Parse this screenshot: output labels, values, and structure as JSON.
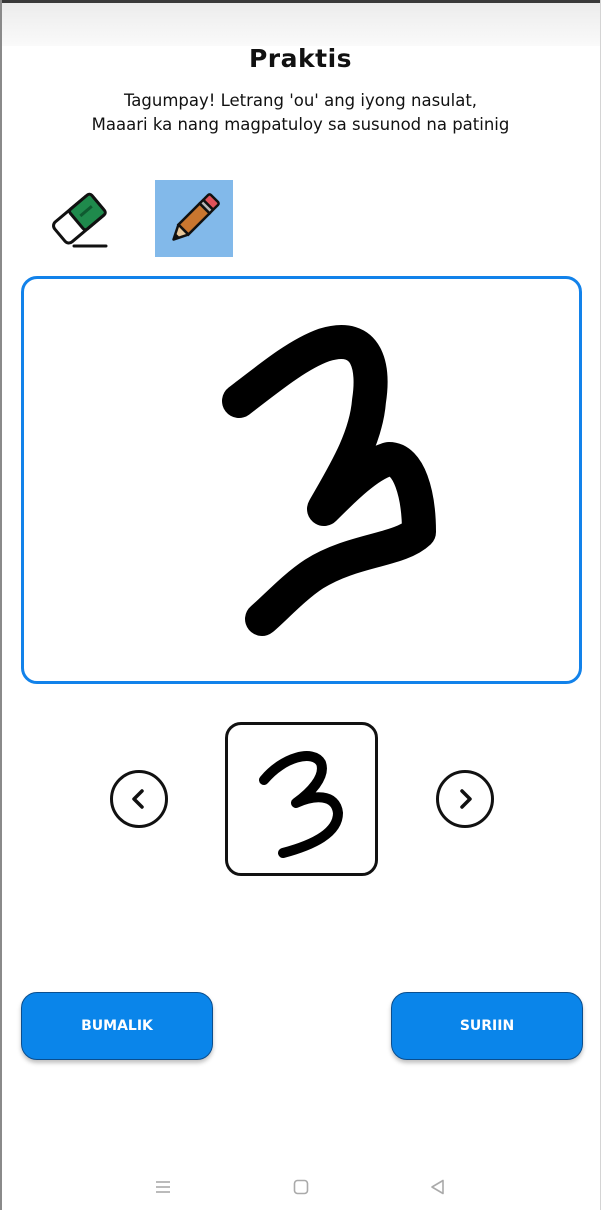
{
  "page": {
    "title": "Praktis",
    "message_line1": "Tagumpay! Letrang 'ou' ang iyong nasulat,",
    "message_line2": "Maaari ka nang magpatuloy sa susunod na patinig"
  },
  "tools": {
    "eraser_icon": "eraser-icon",
    "pencil_icon": "pencil-icon",
    "selected": "pencil"
  },
  "buttons": {
    "back_label": "BUMALIK",
    "check_label": "SURIIN"
  },
  "colors": {
    "accent_blue": "#0a85ea",
    "canvas_border": "#1282ea",
    "selected_tool_bg": "#82b9ea",
    "eraser_green": "#1f8a4c",
    "pencil_orange": "#c9762f",
    "pencil_tip_red": "#e0525a"
  },
  "system_nav": {
    "menu_icon": "menu-lines-icon",
    "home_icon": "home-square-icon",
    "back_icon": "back-triangle-icon"
  }
}
